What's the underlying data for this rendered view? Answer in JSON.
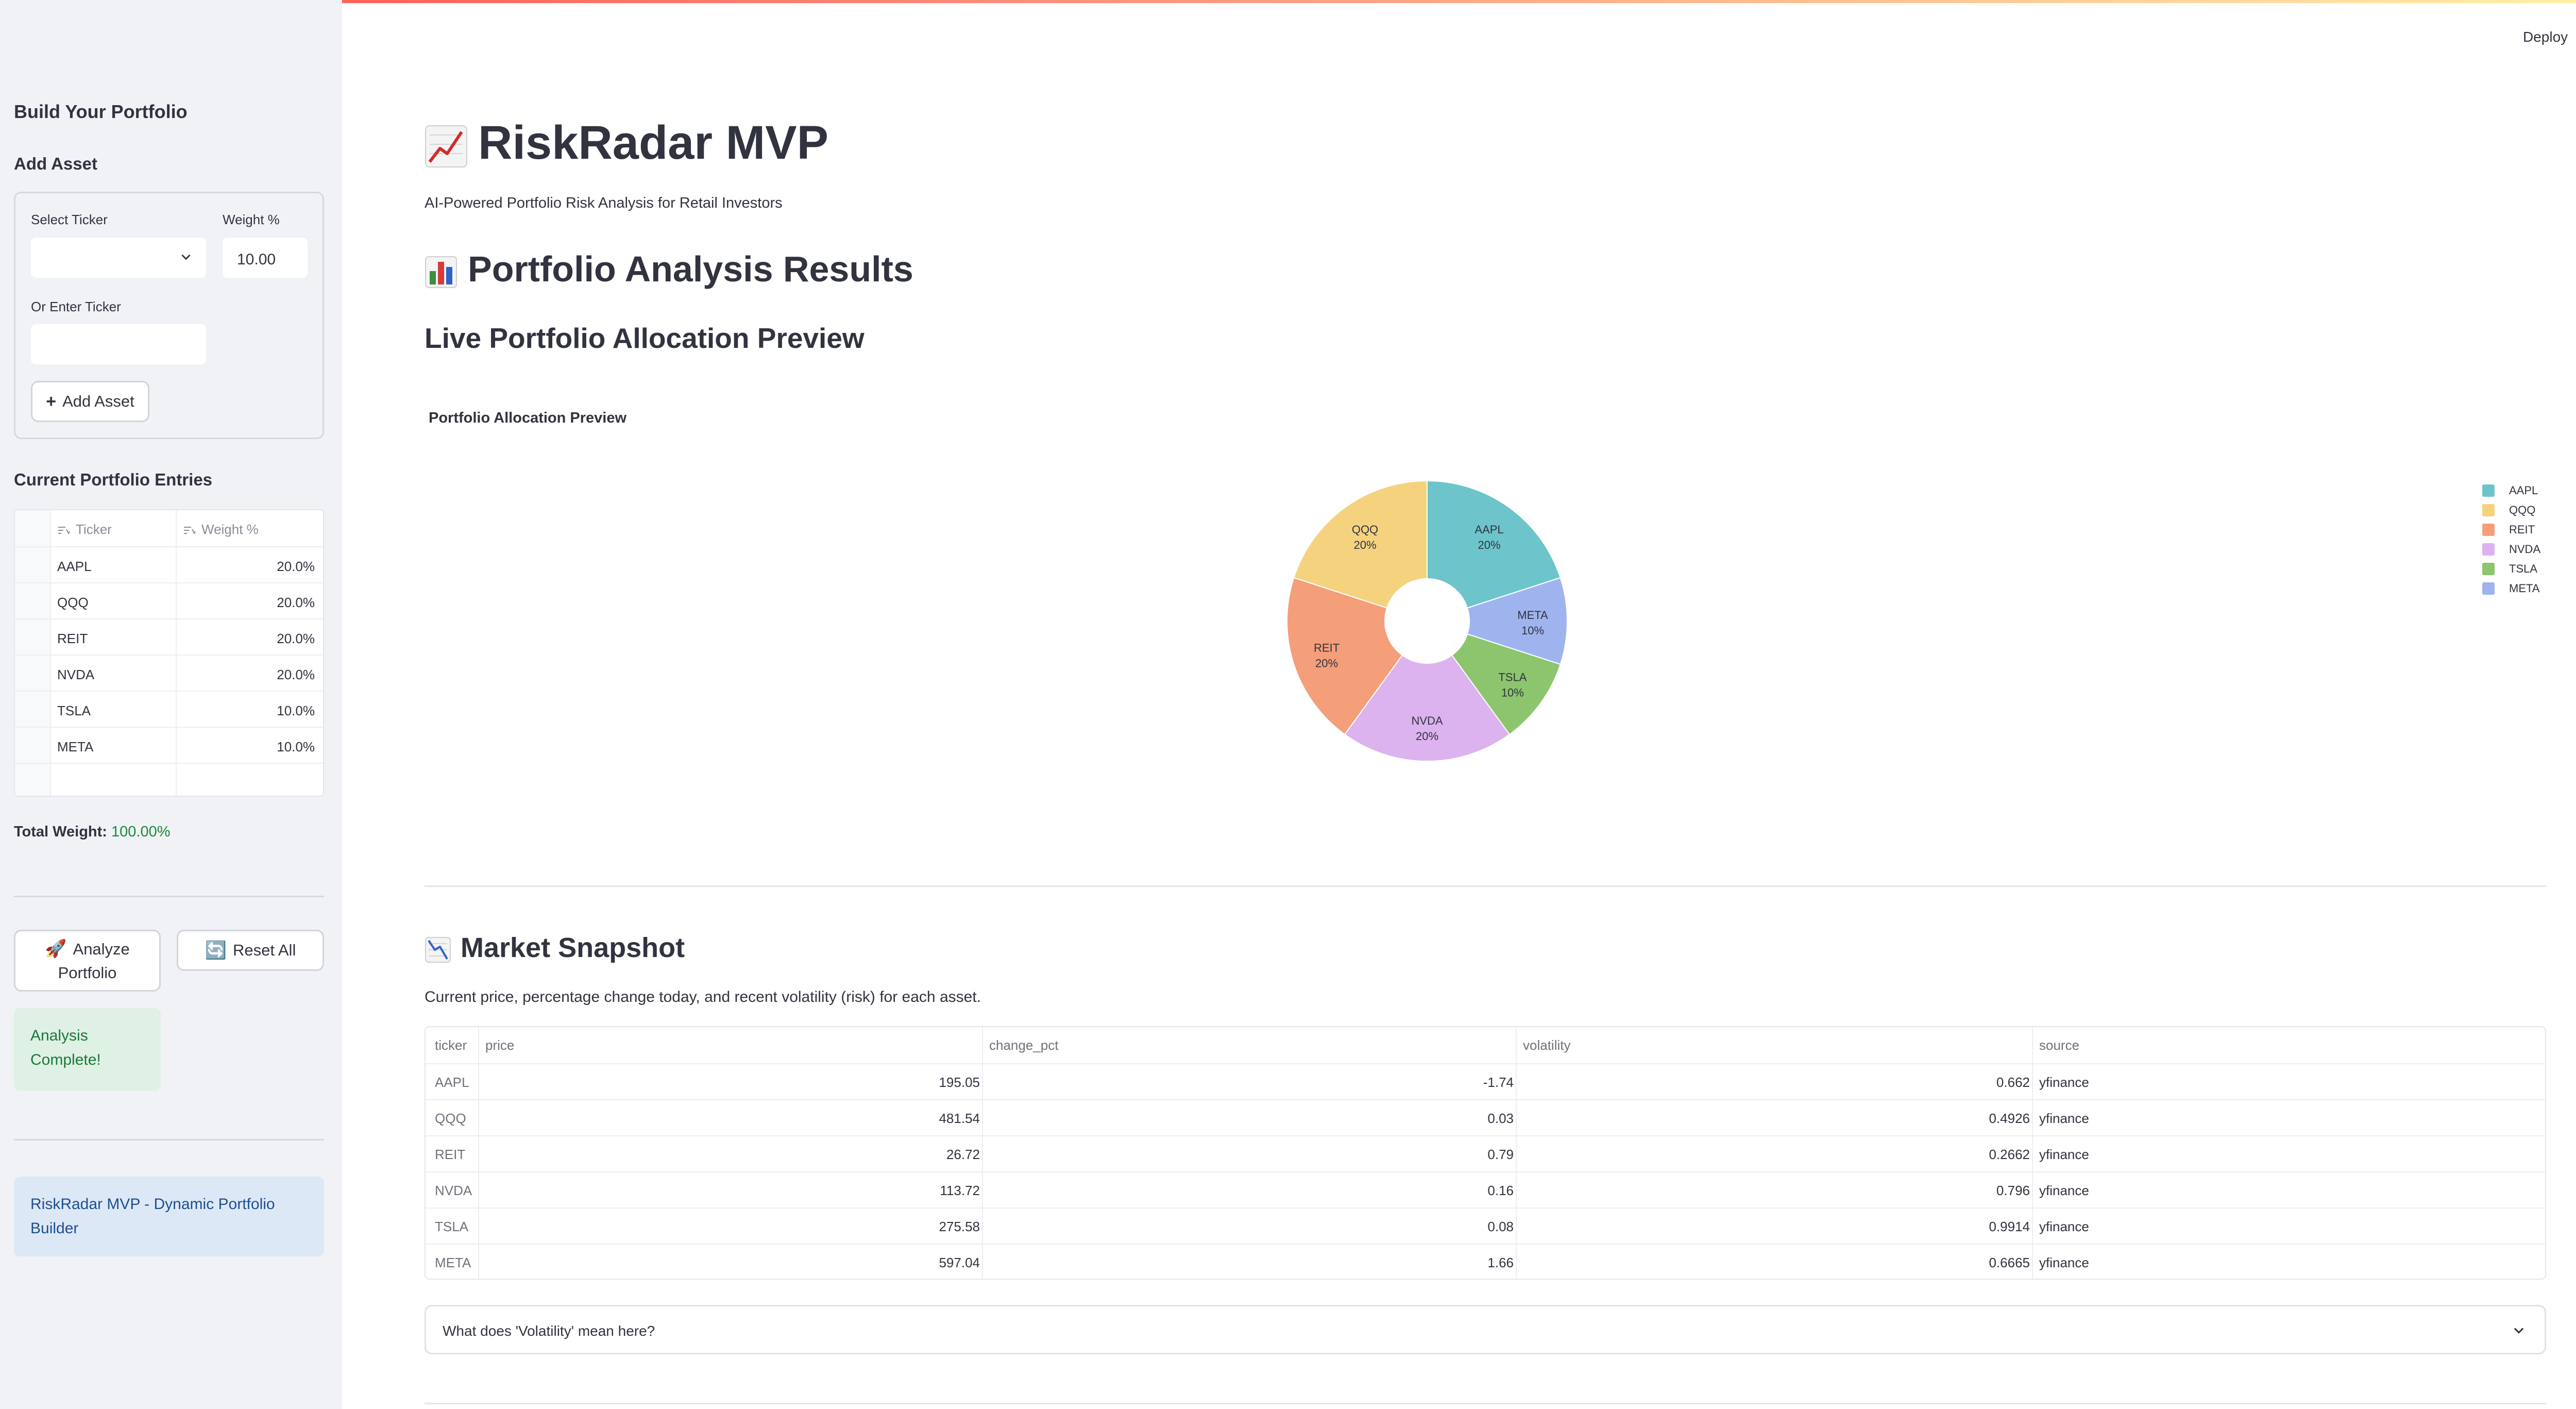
{
  "app": {
    "deploy_label": "Deploy",
    "menu_icon": "kebab-menu-icon"
  },
  "sidebar": {
    "heading": "Build Your Portfolio",
    "add_asset_heading": "Add Asset",
    "select_ticker_label": "Select Ticker",
    "select_ticker_value": "",
    "weight_label": "Weight %",
    "weight_value": "10.00",
    "enter_ticker_label": "Or Enter Ticker",
    "enter_ticker_value": "",
    "add_asset_button": "Add Asset",
    "entries_heading": "Current Portfolio Entries",
    "entries_columns": [
      "Ticker",
      "Weight %"
    ],
    "entries": [
      {
        "ticker": "AAPL",
        "weight": "20.0%"
      },
      {
        "ticker": "QQQ",
        "weight": "20.0%"
      },
      {
        "ticker": "REIT",
        "weight": "20.0%"
      },
      {
        "ticker": "NVDA",
        "weight": "20.0%"
      },
      {
        "ticker": "TSLA",
        "weight": "10.0%"
      },
      {
        "ticker": "META",
        "weight": "10.0%"
      }
    ],
    "total_weight_label": "Total Weight:",
    "total_weight_value": "100.00%",
    "analyze_button_line1": "Analyze",
    "analyze_button_line2": "Portfolio",
    "reset_button": "Reset All",
    "success_line1": "Analysis",
    "success_line2": "Complete!",
    "info_line1": "RiskRadar MVP - Dynamic Portfolio",
    "info_line2": "Builder"
  },
  "main": {
    "title": "RiskRadar MVP",
    "subtitle": "AI-Powered Portfolio Risk Analysis for Retail Investors",
    "results_heading": "Portfolio Analysis Results",
    "preview_heading": "Live Portfolio Allocation Preview",
    "chart_title": "Portfolio Allocation Preview",
    "snapshot_heading": "Market Snapshot",
    "snapshot_desc": "Current price, percentage change today, and recent volatility (risk) for each asset.",
    "table_columns": [
      "ticker",
      "price",
      "change_pct",
      "volatility",
      "source"
    ],
    "table_rows": [
      {
        "ticker": "AAPL",
        "price": "195.05",
        "change_pct": "-1.74",
        "volatility": "0.662",
        "source": "yfinance"
      },
      {
        "ticker": "QQQ",
        "price": "481.54",
        "change_pct": "0.03",
        "volatility": "0.4926",
        "source": "yfinance"
      },
      {
        "ticker": "REIT",
        "price": "26.72",
        "change_pct": "0.79",
        "volatility": "0.2662",
        "source": "yfinance"
      },
      {
        "ticker": "NVDA",
        "price": "113.72",
        "change_pct": "0.16",
        "volatility": "0.796",
        "source": "yfinance"
      },
      {
        "ticker": "TSLA",
        "price": "275.58",
        "change_pct": "0.08",
        "volatility": "0.9914",
        "source": "yfinance"
      },
      {
        "ticker": "META",
        "price": "597.04",
        "change_pct": "1.66",
        "volatility": "0.6665",
        "source": "yfinance"
      }
    ],
    "expander_label": "What does 'Volatility' mean here?"
  },
  "colors": {
    "AAPL": "#6dc5cb",
    "QQQ": "#f5d27e",
    "REIT": "#f59e7a",
    "NVDA": "#dcb3ee",
    "TSLA": "#8cc56d",
    "META": "#9fb4ef",
    "success_text": "#177a3a",
    "total_weight": "#1a8a3a"
  },
  "chart_data": {
    "type": "pie",
    "title": "Portfolio Allocation Preview",
    "categories": [
      "AAPL",
      "META",
      "TSLA",
      "NVDA",
      "REIT",
      "QQQ"
    ],
    "values": [
      20,
      10,
      10,
      20,
      20,
      20
    ],
    "labels": [
      "20%",
      "10%",
      "10%",
      "20%",
      "20%",
      "20%"
    ],
    "legend": [
      "AAPL",
      "QQQ",
      "REIT",
      "NVDA",
      "TSLA",
      "META"
    ],
    "legend_position": "right",
    "donut": true
  }
}
